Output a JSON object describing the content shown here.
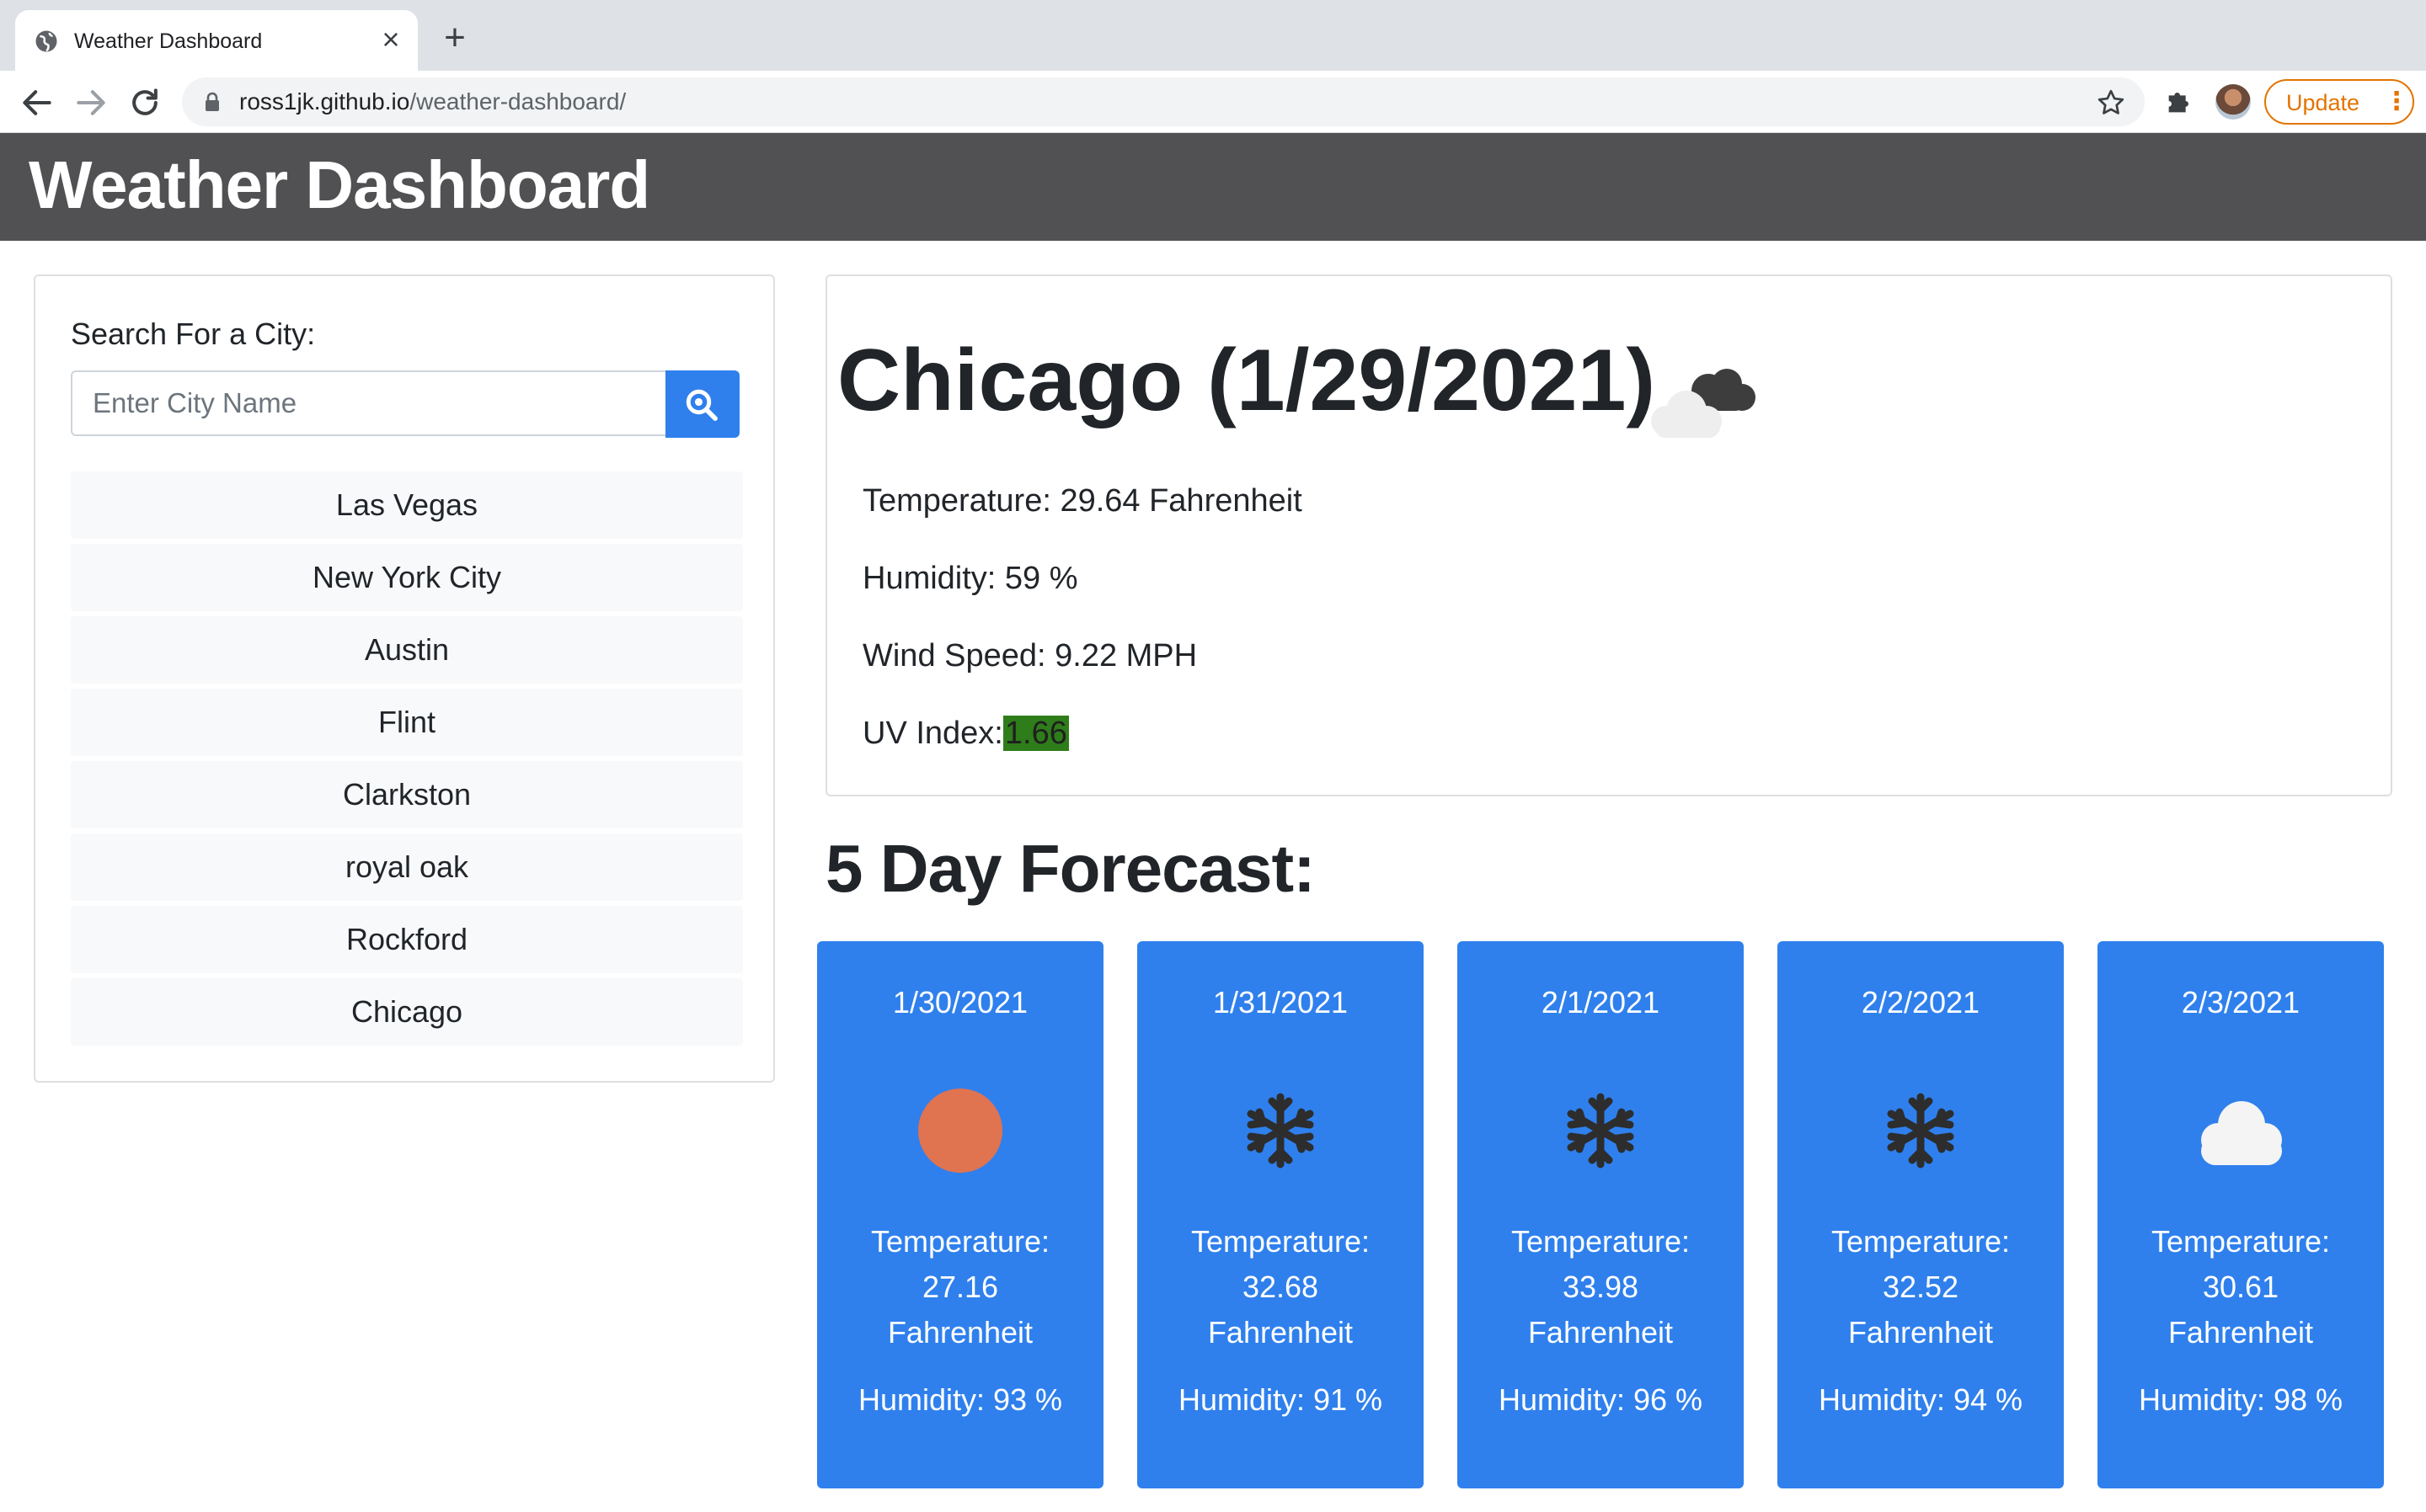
{
  "browser": {
    "tab_title": "Weather Dashboard",
    "new_tab_symbol": "+",
    "close_symbol": "×",
    "url_host": "ross1jk.github.io",
    "url_path": "/weather-dashboard/",
    "update_label": "Update",
    "update_accent": "#e37400"
  },
  "header": {
    "title": "Weather Dashboard",
    "background": "#515154"
  },
  "search": {
    "label": "Search For a City:",
    "placeholder": "Enter City Name",
    "button_icon": "search-icon",
    "button_color": "#2f80ed"
  },
  "history": [
    {
      "label": "Las Vegas"
    },
    {
      "label": "New York City"
    },
    {
      "label": "Austin"
    },
    {
      "label": "Flint"
    },
    {
      "label": "Clarkston"
    },
    {
      "label": "royal oak"
    },
    {
      "label": "Rockford"
    },
    {
      "label": "Chicago"
    }
  ],
  "current": {
    "heading": "Chicago (1/29/2021)",
    "icon": "cloudy-icon",
    "temperature": "Temperature: 29.64 Fahrenheit",
    "humidity": "Humidity: 59 %",
    "wind": "Wind Speed: 9.22 MPH",
    "uv_label": "UV Index:",
    "uv_value": "1.66",
    "uv_color": "#2e7d1a"
  },
  "forecast": {
    "heading": "5 Day Forecast:",
    "card_color": "#2f80ed",
    "days": [
      {
        "date": "1/30/2021",
        "icon": "sun-icon",
        "temp_label": "Temperature:",
        "temp_value": "27.16",
        "temp_unit": "Fahrenheit",
        "humidity": "Humidity: 93 %"
      },
      {
        "date": "1/31/2021",
        "icon": "snow-icon",
        "temp_label": "Temperature:",
        "temp_value": "32.68",
        "temp_unit": "Fahrenheit",
        "humidity": "Humidity: 91 %"
      },
      {
        "date": "2/1/2021",
        "icon": "snow-icon",
        "temp_label": "Temperature:",
        "temp_value": "33.98",
        "temp_unit": "Fahrenheit",
        "humidity": "Humidity: 96 %"
      },
      {
        "date": "2/2/2021",
        "icon": "snow-icon",
        "temp_label": "Temperature:",
        "temp_value": "32.52",
        "temp_unit": "Fahrenheit",
        "humidity": "Humidity: 94 %"
      },
      {
        "date": "2/3/2021",
        "icon": "cloud-icon",
        "temp_label": "Temperature:",
        "temp_value": "30.61",
        "temp_unit": "Fahrenheit",
        "humidity": "Humidity: 98 %"
      }
    ]
  }
}
